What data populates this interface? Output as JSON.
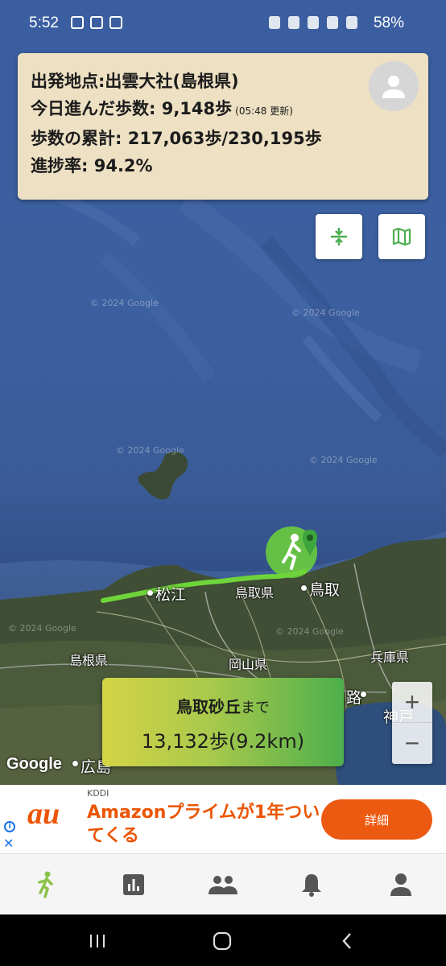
{
  "status_bar": {
    "time": "5:52",
    "battery": "58%"
  },
  "info_card": {
    "origin_label": "出発地点:",
    "origin": "出雲大社(島根県)",
    "today_label": "今日進んだ歩数: ",
    "today_steps": "9,148歩",
    "updated": "(05:48 更新)",
    "total_label": "歩数の累計: ",
    "total_steps": "217,063歩/230,195歩",
    "progress_label": "進捗率: ",
    "progress": "94.2%",
    "progress_fraction": 0.942
  },
  "map": {
    "labels": {
      "matsue": "松江",
      "tottori_pref": "鳥取県",
      "tottori": "鳥取",
      "shimane_pref": "島根県",
      "okayama_pref": "岡山県",
      "hyogo_pref": "兵庫県",
      "kobe": "神戸",
      "hiroshima": "広島",
      "road": "路"
    },
    "watermark": "© 2024 Google",
    "google": "Google",
    "route_color": "#6fd43a",
    "marker_color": "#5cc23a"
  },
  "destination": {
    "name": "鳥取砂丘",
    "suffix": "まで",
    "distance": "13,132歩(9.2km)"
  },
  "zoom": {
    "plus": "+",
    "minus": "−"
  },
  "ad": {
    "brand": "au",
    "sponsor": "KDDI",
    "headline": "Amazonプライムが1年ついてくる",
    "cta": "詳細",
    "info": "i",
    "close": "✕"
  },
  "bottom_nav": {
    "items": [
      {
        "icon": "walk-icon",
        "active": true
      },
      {
        "icon": "chart-icon"
      },
      {
        "icon": "people-icon"
      },
      {
        "icon": "bell-icon"
      },
      {
        "icon": "person-icon"
      }
    ],
    "active_color": "#8bc34a",
    "inactive_color": "#555555"
  }
}
